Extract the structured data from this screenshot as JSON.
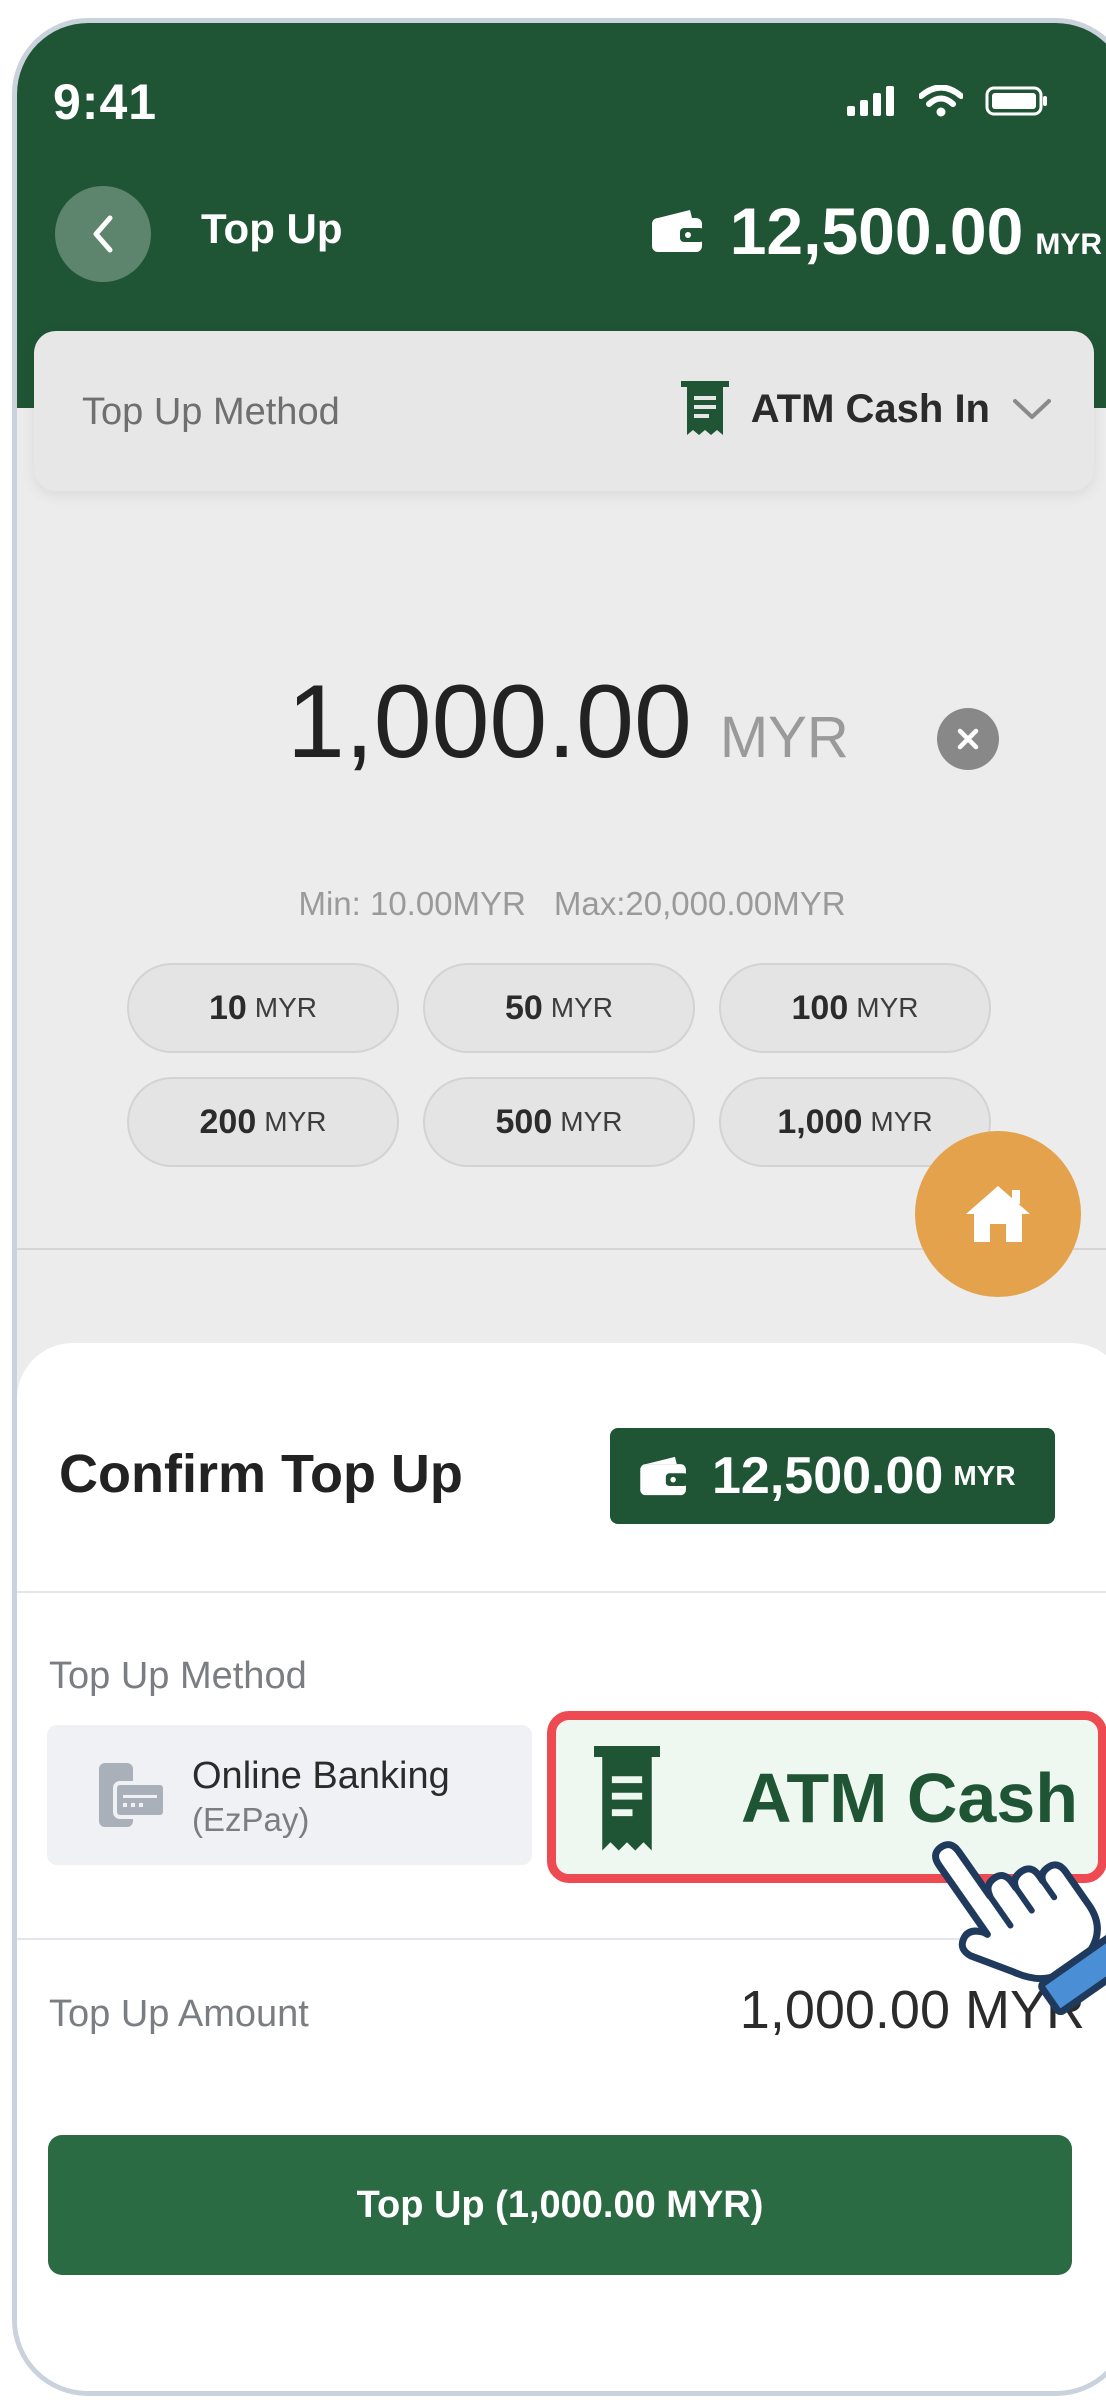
{
  "status_bar": {
    "time": "9:41"
  },
  "header": {
    "title": "Top Up",
    "balance": "12,500.00",
    "currency": "MYR"
  },
  "method_card": {
    "label": "Top Up Method",
    "value": "ATM Cash In"
  },
  "amount": {
    "value": "1,000.00",
    "currency": "MYR",
    "min": "Min: 10.00MYR",
    "max": "Max:20,000.00MYR"
  },
  "quick_amounts": [
    {
      "value": "10",
      "currency": "MYR"
    },
    {
      "value": "50",
      "currency": "MYR"
    },
    {
      "value": "100",
      "currency": "MYR"
    },
    {
      "value": "200",
      "currency": "MYR"
    },
    {
      "value": "500",
      "currency": "MYR"
    },
    {
      "value": "1,000",
      "currency": "MYR"
    }
  ],
  "sheet": {
    "title": "Confirm Top Up",
    "balance": "12,500.00",
    "currency": "MYR",
    "method_label": "Top Up Method",
    "options": [
      {
        "label": "Online Banking",
        "sublabel": "(EzPay)"
      },
      {
        "label": "ATM Cash In"
      }
    ],
    "amount_label": "Top Up Amount",
    "amount_value": "1,000.00 MYR",
    "button_label": "Top Up (1,000.00 MYR)"
  },
  "colors": {
    "brand_green": "#1f5535",
    "button_green": "#2a6b43",
    "highlight_red": "#ee4a52",
    "fab_orange": "#e3a24b"
  },
  "icons": [
    "back-chevron-icon",
    "wallet-icon",
    "receipt-icon",
    "chevron-down-icon",
    "clear-icon",
    "home-icon",
    "mobile-card-icon",
    "hand-pointer-icon",
    "signal-icon",
    "wifi-icon",
    "battery-icon"
  ]
}
